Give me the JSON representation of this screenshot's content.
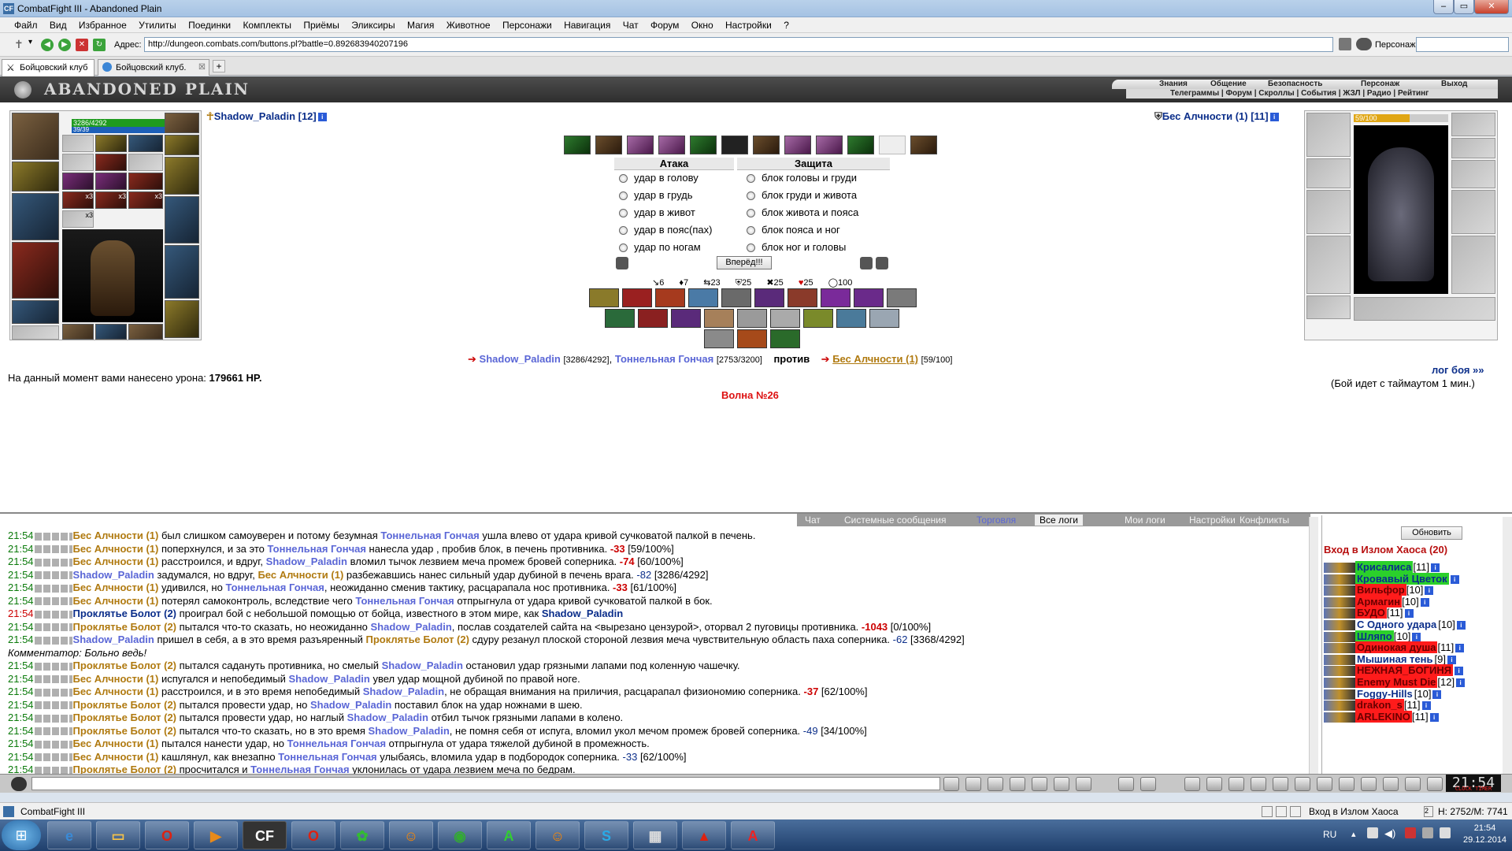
{
  "window": {
    "title": "CombatFight III - Abandoned Plain",
    "icon": "CF"
  },
  "menu": [
    "Файл",
    "Вид",
    "Избранное",
    "Утилиты",
    "Поединки",
    "Комплекты",
    "Приёмы",
    "Эликсиры",
    "Магия",
    "Животное",
    "Персонажи",
    "Навигация",
    "Чат",
    "Форум",
    "Окно",
    "Настройки",
    "?"
  ],
  "address": {
    "label": "Адрес:",
    "url": "http://dungeon.combats.com/buttons.pl?battle=0.892683940207196",
    "pers_label": "Персонаж:"
  },
  "tabs": [
    {
      "label": "Бойцовский клуб"
    },
    {
      "label": "Бойцовский клуб."
    }
  ],
  "game_header": {
    "logo": "ABANDONED PLAIN",
    "nav": [
      "Знания",
      "Общение",
      "Безопасность",
      "Персонаж",
      "Выход"
    ],
    "subnav": "Телеграммы | Форум | Скроллы | События | ЖЗЛ | Радио | Рейтинг"
  },
  "player": {
    "name": "Shadow_Paladin [12]",
    "hp": "3286/4292",
    "mp": "39/39",
    "stack1": "x3",
    "stack2": "x3",
    "stack3": "x3",
    "stack4": "x3"
  },
  "enemy": {
    "name": "Бес Алчности (1) [11]",
    "hp": "59/100"
  },
  "battle": {
    "attack_header": "Атака",
    "defense_header": "Защита",
    "attacks": [
      "удар в голову",
      "удар в грудь",
      "удар в живот",
      "удар в пояс(пах)",
      "удар по ногам"
    ],
    "blocks": [
      "блок головы и груди",
      "блок груди и живота",
      "блок живота и пояса",
      "блок пояса и ног",
      "блок ног и головы"
    ],
    "forward_button": "Вперёд!!!",
    "stats": [
      "6",
      "7",
      "23",
      "25",
      "25",
      "25",
      "100"
    ],
    "vs_line": {
      "p1": "Shadow_Paladin",
      "p1_hp": "[3286/4292]",
      "p2": "Тоннельная Гончая",
      "p2_hp": "[2753/3200]",
      "vs": "против",
      "enemy": "Бес Алчности (1)",
      "enemy_hp": "[59/100]"
    },
    "damage_label": "На данный момент вами нанесено урона:",
    "damage_value": "179661 HP.",
    "log_link": "лог боя »»",
    "timeout": "(Бой идет с таймаутом 1 мин.)",
    "wave": "Волна №26"
  },
  "chat_tabs": [
    "Чат",
    "Системные сообщения",
    "Торговля",
    "Все логи",
    "Мои логи",
    "Настройки",
    "Конфликты"
  ],
  "log": [
    {
      "t": "21:54",
      "parts": [
        [
          "en",
          "Бес Алчности (1)"
        ],
        [
          "x",
          " был слишком самоуверен и потому безумная "
        ],
        [
          "me",
          "Тоннельная Гончая"
        ],
        [
          "x",
          " ушла влево от удара кривой сучковатой палкой в печень."
        ]
      ]
    },
    {
      "t": "21:54",
      "parts": [
        [
          "en",
          "Бес Алчности (1)"
        ],
        [
          "x",
          " поперхнулся, и за это "
        ],
        [
          "me",
          "Тоннельная Гончая"
        ],
        [
          "x",
          " нанесла удар , пробив блок, в печень противника. "
        ],
        [
          "dm",
          "-33"
        ],
        [
          "x",
          " [59/100%]"
        ]
      ]
    },
    {
      "t": "21:54",
      "parts": [
        [
          "en",
          "Бес Алчности (1)"
        ],
        [
          "x",
          " расстроился, и вдруг, "
        ],
        [
          "me",
          "Shadow_Paladin"
        ],
        [
          "x",
          " вломил тычок лезвием меча промеж бровей соперника. "
        ],
        [
          "dm",
          "-74"
        ],
        [
          "x",
          " [60/100%]"
        ]
      ]
    },
    {
      "t": "21:54",
      "parts": [
        [
          "me",
          "Shadow_Paladin"
        ],
        [
          "x",
          " задумался, но вдруг, "
        ],
        [
          "en",
          "Бес Алчности (1)"
        ],
        [
          "x",
          " разбежавшись нанес сильный удар дубиной в печень врага. "
        ],
        [
          "nb",
          "-82"
        ],
        [
          "x",
          " [3286/4292]"
        ]
      ]
    },
    {
      "t": "21:54",
      "parts": [
        [
          "en",
          "Бес Алчности (1)"
        ],
        [
          "x",
          " удивился, но "
        ],
        [
          "me",
          "Тоннельная Гончая"
        ],
        [
          "x",
          ", неожиданно сменив тактику, расцарапала нос противника. "
        ],
        [
          "dm",
          "-33"
        ],
        [
          "x",
          " [61/100%]"
        ]
      ]
    },
    {
      "t": "21:54",
      "parts": [
        [
          "en",
          "Бес Алчности (1)"
        ],
        [
          "x",
          " потерял самоконтроль, вследствие чего "
        ],
        [
          "me",
          "Тоннельная Гончая"
        ],
        [
          "x",
          " отпрыгнула от удара кривой сучковатой палкой в бок."
        ]
      ]
    },
    {
      "t": "21:54",
      "red": true,
      "parts": [
        [
          "bl",
          "Проклятье Болот (2)"
        ],
        [
          "x",
          " проиграл бой с небольшой помощью от бойца, известного в этом мире, как "
        ],
        [
          "bl",
          "Shadow_Paladin"
        ]
      ]
    },
    {
      "t": "21:54",
      "parts": [
        [
          "en",
          "Проклятье Болот (2)"
        ],
        [
          "x",
          " пытался что-то сказать, но неожиданно "
        ],
        [
          "me",
          "Shadow_Paladin"
        ],
        [
          "x",
          ", послав создателей сайта на <вырезано цензурой>, оторвал 2 пуговицы противника. "
        ],
        [
          "dm",
          "-1043"
        ],
        [
          "x",
          " [0/100%]"
        ]
      ]
    },
    {
      "t": "21:54",
      "parts": [
        [
          "me",
          "Shadow_Paladin"
        ],
        [
          "x",
          " пришел в себя, а в это время разъяренный "
        ],
        [
          "en",
          "Проклятье Болот (2)"
        ],
        [
          "x",
          " сдуру резанул плоской стороной лезвия меча чувствительную область паха соперника. "
        ],
        [
          "nb",
          "-62"
        ],
        [
          "x",
          " [3368/4292]"
        ]
      ]
    },
    {
      "t": "",
      "comment": "Комментатор: Больно ведь!",
      "parts": []
    },
    {
      "t": "21:54",
      "parts": [
        [
          "en",
          "Проклятье Болот (2)"
        ],
        [
          "x",
          " пытался садануть противника, но смелый "
        ],
        [
          "me",
          "Shadow_Paladin"
        ],
        [
          "x",
          " остановил удар грязными лапами под коленную чашечку."
        ]
      ]
    },
    {
      "t": "21:54",
      "parts": [
        [
          "en",
          "Бес Алчности (1)"
        ],
        [
          "x",
          " испугался и непобедимый "
        ],
        [
          "me",
          "Shadow_Paladin"
        ],
        [
          "x",
          " увел удар мощной дубиной по правой ноге."
        ]
      ]
    },
    {
      "t": "21:54",
      "parts": [
        [
          "en",
          "Бес Алчности (1)"
        ],
        [
          "x",
          " расстроился, и в это время непобедимый "
        ],
        [
          "me",
          "Shadow_Paladin"
        ],
        [
          "x",
          ", не обращая внимания на приличия, расцарапал физиономию соперника. "
        ],
        [
          "dm",
          "-37"
        ],
        [
          "x",
          " [62/100%]"
        ]
      ]
    },
    {
      "t": "21:54",
      "parts": [
        [
          "en",
          "Проклятье Болот (2)"
        ],
        [
          "x",
          " пытался провести удар, но "
        ],
        [
          "me",
          "Shadow_Paladin"
        ],
        [
          "x",
          " поставил блок на удар ножнами в шею."
        ]
      ]
    },
    {
      "t": "21:54",
      "parts": [
        [
          "en",
          "Проклятье Болот (2)"
        ],
        [
          "x",
          " пытался провести удар, но наглый "
        ],
        [
          "me",
          "Shadow_Paladin"
        ],
        [
          "x",
          " отбил тычок грязными лапами в колено."
        ]
      ]
    },
    {
      "t": "21:54",
      "parts": [
        [
          "en",
          "Проклятье Болот (2)"
        ],
        [
          "x",
          " пытался что-то сказать, но в это время "
        ],
        [
          "me",
          "Shadow_Paladin"
        ],
        [
          "x",
          ", не помня себя от испуга, вломил укол мечом промеж бровей соперника. "
        ],
        [
          "nb",
          "-49"
        ],
        [
          "x",
          " [34/100%]"
        ]
      ]
    },
    {
      "t": "21:54",
      "parts": [
        [
          "en",
          "Бес Алчности (1)"
        ],
        [
          "x",
          " пытался нанести удар, но "
        ],
        [
          "me",
          "Тоннельная Гончая"
        ],
        [
          "x",
          " отпрыгнула от удара тяжелой дубиной в промежность."
        ]
      ]
    },
    {
      "t": "21:54",
      "parts": [
        [
          "en",
          "Бес Алчности (1)"
        ],
        [
          "x",
          " кашлянул, как внезапно "
        ],
        [
          "me",
          "Тоннельная Гончая"
        ],
        [
          "x",
          " улыбаясь, вломила удар в подбородок соперника. "
        ],
        [
          "nb",
          "-33"
        ],
        [
          "x",
          " [62/100%]"
        ]
      ]
    },
    {
      "t": "21:54",
      "parts": [
        [
          "en",
          "Проклятье Болот (2)"
        ],
        [
          "x",
          " просчитался и "
        ],
        [
          "me",
          "Тоннельная Гончая"
        ],
        [
          "x",
          " уклонилась от удара лезвием меча по бедрам."
        ]
      ]
    }
  ],
  "side": {
    "refresh": "Обновить",
    "title": "Вход в Излом Хаоса (20)",
    "players": [
      {
        "name": "Крисалиса",
        "lvl": "[11]",
        "c": "gn"
      },
      {
        "name": "Кровавый Цветок",
        "lvl": "",
        "c": "gn"
      },
      {
        "name": "Вильфор",
        "lvl": "[10]",
        "c": "rd"
      },
      {
        "name": "Армагин",
        "lvl": "[10]",
        "c": "rd"
      },
      {
        "name": "БУДО",
        "lvl": "[11]",
        "c": "rd"
      },
      {
        "name": "С Одного удара",
        "lvl": "[10]",
        "c": "no"
      },
      {
        "name": "Шляпо",
        "lvl": "[10]",
        "c": "gn"
      },
      {
        "name": "Одинокая душа",
        "lvl": "[11]",
        "c": "rd"
      },
      {
        "name": "Мышиная тень",
        "lvl": "[9]",
        "c": "no"
      },
      {
        "name": "НЕЖНАЯ_БОГИНЯ",
        "lvl": "",
        "c": "rd"
      },
      {
        "name": "Enemy Must Die",
        "lvl": "[12]",
        "c": "rd"
      },
      {
        "name": "Foggy-Hills",
        "lvl": "[10]",
        "c": "no"
      },
      {
        "name": "drakon_s",
        "lvl": "[11]",
        "c": "rd"
      },
      {
        "name": "ARLEKINO",
        "lvl": "[11]",
        "c": "rd"
      }
    ]
  },
  "toolbar": {
    "clock": "21:54",
    "clock_sub": "CLOCK TIMER"
  },
  "status": {
    "app": "CombatFight III",
    "location": "Вход в Излом Хаоса",
    "coords": "H: 2752/M: 7741"
  },
  "taskbar": {
    "lang": "RU",
    "time": "21:54",
    "date": "29.12.2014"
  }
}
